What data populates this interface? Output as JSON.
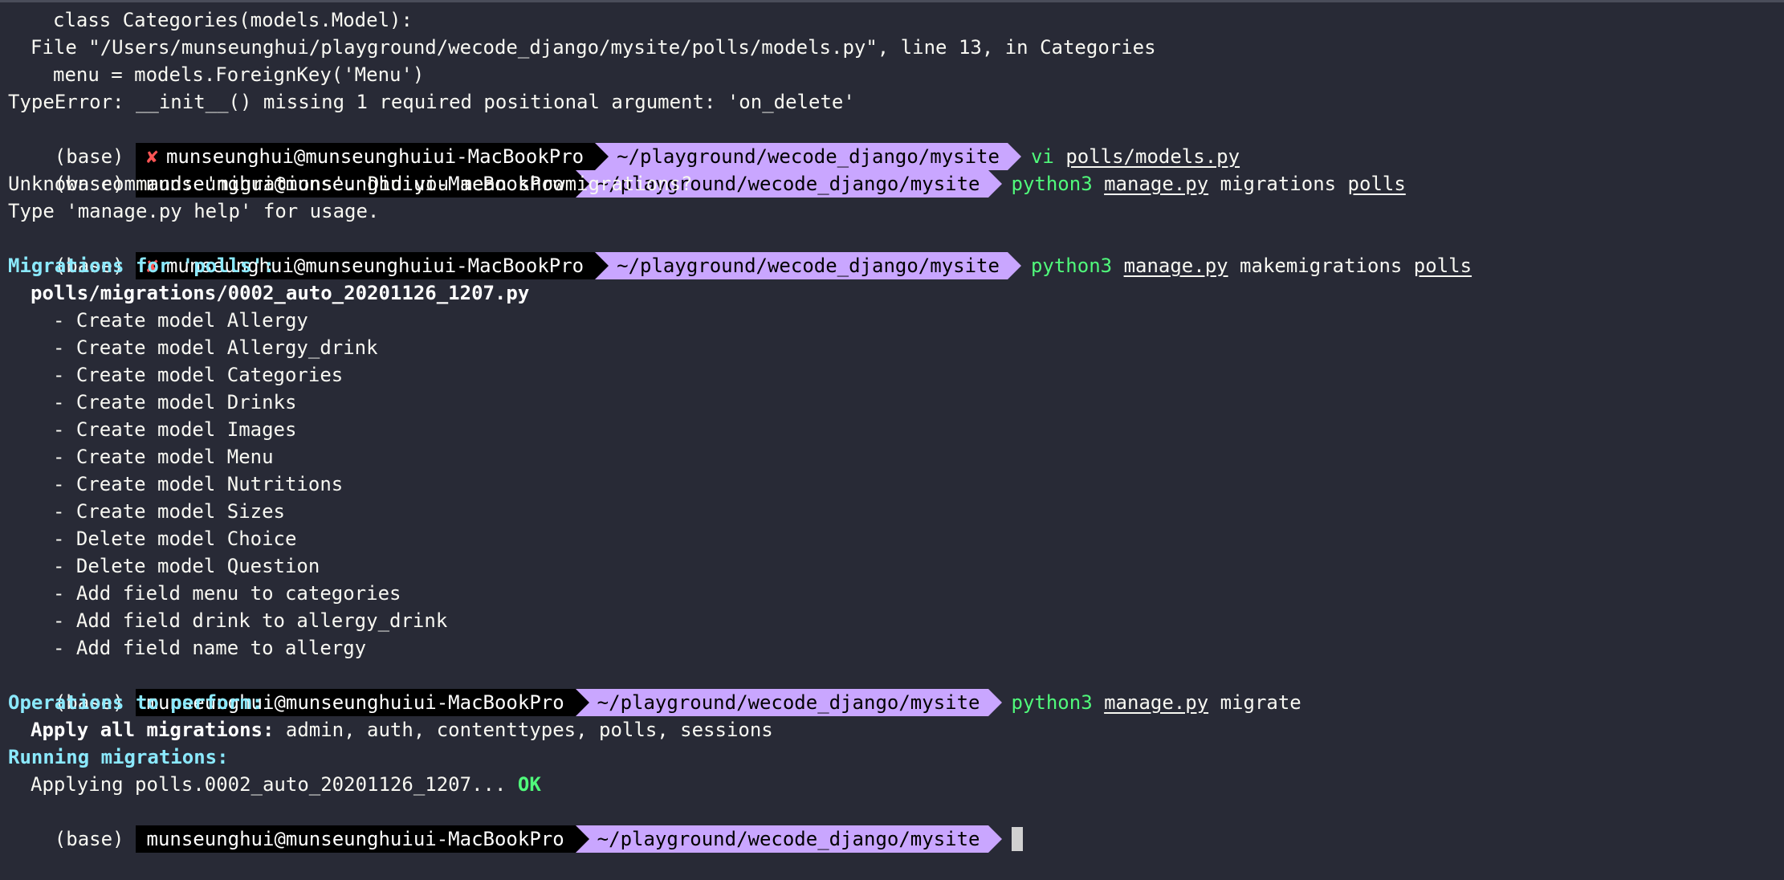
{
  "lines": {
    "l0": "class Categories(models.Model):",
    "l1": "File \"/Users/munseunghui/playground/wecode_django/mysite/polls/models.py\", line 13, in Categories",
    "l2": "menu = models.ForeignKey('Menu')",
    "l3": "TypeError: __init__() missing 1 required positional argument: 'on_delete'",
    "l6": "Unknown command: 'migrations'. Did you mean showmigrations?",
    "l7": "Type 'manage.py help' for usage.",
    "l9": "Migrations for 'polls':",
    "l10": "polls/migrations/0002_auto_20201126_1207.py",
    "l11": "- Create model Allergy",
    "l12": "- Create model Allergy_drink",
    "l13": "- Create model Categories",
    "l14": "- Create model Drinks",
    "l15": "- Create model Images",
    "l16": "- Create model Menu",
    "l17": "- Create model Nutritions",
    "l18": "- Create model Sizes",
    "l19": "- Delete model Choice",
    "l20": "- Delete model Question",
    "l21": "- Add field menu to categories",
    "l22": "- Add field drink to allergy_drink",
    "l23": "- Add field name to allergy",
    "l25": "Operations to perform:",
    "l26_label": "Apply all migrations:",
    "l26_value": " admin, auth, contenttypes, polls, sessions",
    "l27": "Running migrations:",
    "l28": "Applying polls.0002_auto_20201126_1207...",
    "l28_ok": " OK"
  },
  "prompt": {
    "env": "(base)",
    "user": "munseunghui@munseunghuiui-MacBookPro",
    "path": "~/playground/wecode_django/mysite",
    "error_icon": "✘"
  },
  "cmds": {
    "c1_bin": "vi",
    "c1_arg": "polls/models.py",
    "c2_bin": "python3",
    "c2_file": "manage.py",
    "c2_mid": " migrations ",
    "c2_app": "polls",
    "c3_bin": "python3",
    "c3_file": "manage.py",
    "c3_mid": " makemigrations ",
    "c3_app": "polls",
    "c4_bin": "python3",
    "c4_file": "manage.py",
    "c4_tail": " migrate"
  },
  "colors": {
    "background": "#282a36",
    "path_segment": "#c9a6ff",
    "user_segment": "#000000",
    "heading": "#8be9fd",
    "command": "#50fa7b",
    "error_icon": "#ff5555"
  }
}
